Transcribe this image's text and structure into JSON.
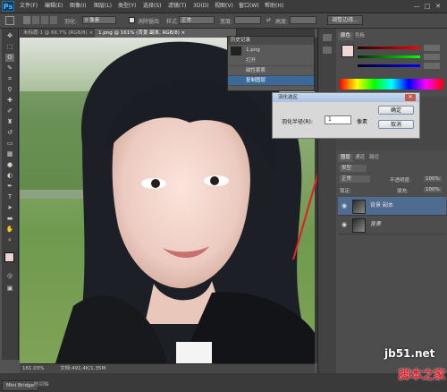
{
  "app": {
    "logo": "Ps"
  },
  "menu": [
    "文件(F)",
    "编辑(E)",
    "图像(I)",
    "图层(L)",
    "类型(Y)",
    "选择(S)",
    "滤镜(T)",
    "3D(D)",
    "视图(V)",
    "窗口(W)",
    "帮助(H)"
  ],
  "window_controls": [
    "—",
    "□",
    "✕"
  ],
  "options": {
    "feather_label": "羽化:",
    "feather_value": "0 像素",
    "antialias_label": "消除锯齿",
    "style_label": "样式:",
    "style_value": "正常",
    "width_label": "宽度:",
    "height_label": "高度:",
    "adjust_edge": "调整边缘..."
  },
  "tabs": [
    {
      "label": "未标题-1 @ 66.7% (RGB/8) ×",
      "active": false
    },
    {
      "label": "1.png @ 161% (背景 副本, RGB/8) ×",
      "active": true
    }
  ],
  "status": {
    "zoom": "161.03%",
    "doc": "文档:491.4K/1.35M"
  },
  "bottom": {
    "minibridge": "Mini Bridge",
    "timeline": "时间轴"
  },
  "history": {
    "tab_label": "历史记录",
    "snapshot_label": "1.png",
    "items": [
      "打开",
      "磁性套索",
      "复制图层"
    ],
    "selected_index": 2
  },
  "dialog": {
    "title": "羽化选区",
    "radius_label": "羽化半径(R):",
    "radius_value": "1",
    "unit": "像素",
    "ok": "确定",
    "cancel": "取消"
  },
  "panels": {
    "color_tabs": [
      "颜色",
      "色板"
    ],
    "layer_tabs": [
      "图层",
      "通道",
      "路径"
    ],
    "filter_label": "类型",
    "blend_mode": "正常",
    "opacity_label": "不透明度:",
    "opacity_value": "100%",
    "lock_label": "锁定:",
    "fill_label": "填充:",
    "fill_value": "100%",
    "layers": [
      {
        "name": "背景 副本",
        "selected": true
      },
      {
        "name": "背景",
        "selected": false
      }
    ]
  },
  "watermark": {
    "line1": "jb51.net",
    "line2": "脚本之家"
  },
  "colors": {
    "accent": "#3b6a9a",
    "arrow": "#e0202a"
  }
}
